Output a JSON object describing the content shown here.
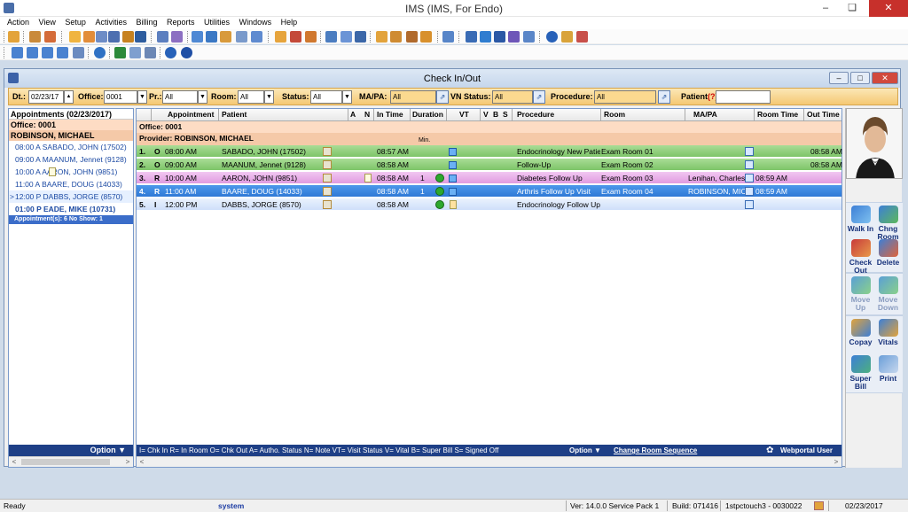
{
  "app": {
    "title": "IMS (IMS, For Endo)"
  },
  "menu": [
    "Action",
    "View",
    "Setup",
    "Activities",
    "Billing",
    "Reports",
    "Utilities",
    "Windows",
    "Help"
  ],
  "window": {
    "title": "Check In/Out"
  },
  "filters": {
    "dt_label": "Dt.:",
    "dt_value": "02/23/17",
    "office_label": "Office:",
    "office_value": "0001",
    "pr_label": "Pr.:",
    "pr_value": "All",
    "room_label": "Room:",
    "room_value": "All",
    "status_label": "Status:",
    "status_value": "All",
    "mapa_label": "MA/PA:",
    "mapa_value": "All",
    "vn_label": "VN Status:",
    "vn_value": "All",
    "proc_label": "Procedure:",
    "proc_value": "All",
    "patient_label": "Patient",
    "patient_hint": "(?)",
    "patient_value": ""
  },
  "left": {
    "header": "Appointments (02/23/2017)",
    "office": "Office: 0001",
    "provider": "ROBINSON, MICHAEL",
    "rows": [
      {
        "text": "08:00 A   SABADO, JOHN  (17502)"
      },
      {
        "text": "09:00 A   MAANUM, Jennet  (9128)"
      },
      {
        "text": "10:00 A        AARON, JOHN  (9851)"
      },
      {
        "text": "11:00 A   BAARE, DOUG  (14033)"
      },
      {
        "text": "12:00 P   DABBS, JORGE  (8570)",
        "arrow": ">"
      },
      {
        "text": "01:00 P   EADE, MIKE  (10731)"
      }
    ],
    "footer": "Appointment(s): 6   No Show: 1",
    "option": "Option ▼"
  },
  "grid": {
    "headers": {
      "appointment": "Appointment",
      "patient": "Patient",
      "a": "A",
      "n": "N",
      "intime": "In Time",
      "duration": "Duration",
      "vt": "VT",
      "v": "V",
      "b": "B",
      "s": "S",
      "procedure": "Procedure",
      "room": "Room",
      "mapa": "MA/PA",
      "roomtime": "Room Time",
      "outtime": "Out Time"
    },
    "office": "Office: 0001",
    "provider": "Provider: ROBINSON, MICHAEL",
    "min": "Min.",
    "rows": [
      {
        "num": "1.",
        "st": "O",
        "time": "08:00 AM",
        "patient": "SABADO, JOHN  (17502)",
        "intime": "08:57 AM",
        "duration": "",
        "procedure": "Endocrinology New Patien",
        "room": "Exam Room 01",
        "mapa": "",
        "roomtime": "",
        "outtime": "08:58 AM"
      },
      {
        "num": "2.",
        "st": "O",
        "time": "09:00 AM",
        "patient": "MAANUM, Jennet  (9128)",
        "intime": "08:58 AM",
        "duration": "",
        "procedure": "Follow-Up",
        "room": "Exam Room 02",
        "mapa": "",
        "roomtime": "",
        "outtime": "08:58 AM"
      },
      {
        "num": "3.",
        "st": "R",
        "time": "10:00 AM",
        "patient": "AARON, JOHN  (9851)",
        "intime": "08:58 AM",
        "duration": "1",
        "procedure": "Diabetes Follow Up",
        "room": "Exam Room 03",
        "mapa": "Lenihan, Charles",
        "roomtime": "08:59 AM",
        "outtime": ""
      },
      {
        "num": "4.",
        "st": "R",
        "time": "11:00 AM",
        "patient": "BAARE, DOUG  (14033)",
        "intime": "08:58 AM",
        "duration": "1",
        "procedure": "Arthris Follow Up Visit",
        "room": "Exam Room 04",
        "mapa": "ROBINSON, MIC",
        "roomtime": "08:59 AM",
        "outtime": ""
      },
      {
        "num": "5.",
        "st": "I",
        "time": "12:00 PM",
        "patient": "DABBS, JORGE  (8570)",
        "intime": "08:58 AM",
        "duration": "",
        "procedure": "Endocrinology Follow Up",
        "room": "",
        "mapa": "",
        "roomtime": "",
        "outtime": ""
      }
    ],
    "legend": "I= Chk In  R= In Room O= Chk Out  A= Autho. Status  N= Note  VT= Visit Status  V= Vital  B= Super Bill  S= Signed Off",
    "option": "Option ▼",
    "change_room": "Change Room Sequence",
    "webportal": "Webportal User"
  },
  "actions": {
    "walkin": "Walk In",
    "chngroom": "Chng Room",
    "checkout": "Check Out",
    "delete": "Delete",
    "moveup": "Move Up",
    "movedown": "Move Down",
    "copay": "Copay",
    "vitals": "Vitals",
    "superbill": "Super Bill",
    "print": "Print"
  },
  "status": {
    "ready": "Ready",
    "user": "system",
    "version": "Ver: 14.0.0 Service Pack 1",
    "build": "Build: 071416",
    "station": "1stpctouch3 - 0030022",
    "date": "02/23/2017"
  },
  "colors": {
    "green_row": "#7dc468",
    "pink_row": "#e09be0",
    "selected_row": "#2e79d6",
    "filter_bar": "#f5c873",
    "footer": "#1e3f86"
  }
}
